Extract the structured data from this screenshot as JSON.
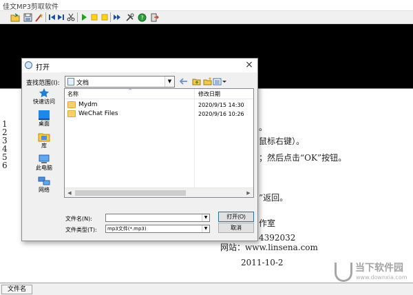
{
  "app": {
    "title": "佳文MP3剪取软件",
    "status_label": "文件名"
  },
  "toolbar": {
    "icons": [
      "open-file-icon",
      "save-file-icon",
      "cut-magic-icon",
      "skip-start-icon",
      "skip-end-icon",
      "scissors-icon",
      "play-icon",
      "mark-start-icon",
      "mark-end-icon",
      "fast-forward-icon",
      "tools-icon",
      "help-icon",
      "exit-icon"
    ]
  },
  "background_text": {
    "numbers": [
      "1",
      "2",
      "3",
      "4",
      "5",
      "6"
    ],
    "right_click_hint": "鼠标右键）。",
    "ok_hint": "；然后点击“OK”按钮。",
    "return_hint": "”返回。",
    "studio": "作室",
    "phone": "4392032",
    "website": "网站：www.linsena.com",
    "date": "2011-10-2"
  },
  "dialog": {
    "title": "打开",
    "look_in_label": "查找范围(I):",
    "look_in_value": "文档",
    "columns": {
      "name": "名称",
      "date": "修改日期"
    },
    "files": [
      {
        "name": "Mydm",
        "date": "2020/9/15 14:30"
      },
      {
        "name": "WeChat Files",
        "date": "2020/9/16 10:26"
      }
    ],
    "places": [
      {
        "label": "快速访问",
        "icon": "star-icon"
      },
      {
        "label": "桌面",
        "icon": "desktop-icon"
      },
      {
        "label": "库",
        "icon": "library-icon"
      },
      {
        "label": "此电脑",
        "icon": "computer-icon"
      },
      {
        "label": "网络",
        "icon": "network-icon"
      }
    ],
    "filename_label": "文件名(N):",
    "filename_value": "",
    "filetype_label": "文件类型(T):",
    "filetype_value": "mp3文件(*.mp3)",
    "open_button": "打开(O)",
    "cancel_button": "取消"
  },
  "watermark": {
    "title": "当下软件园",
    "url": "www.downxia.com"
  },
  "colors": {
    "folder": "#f4cf6b",
    "wave_bg": "#000000",
    "accent": "#0078d7"
  }
}
